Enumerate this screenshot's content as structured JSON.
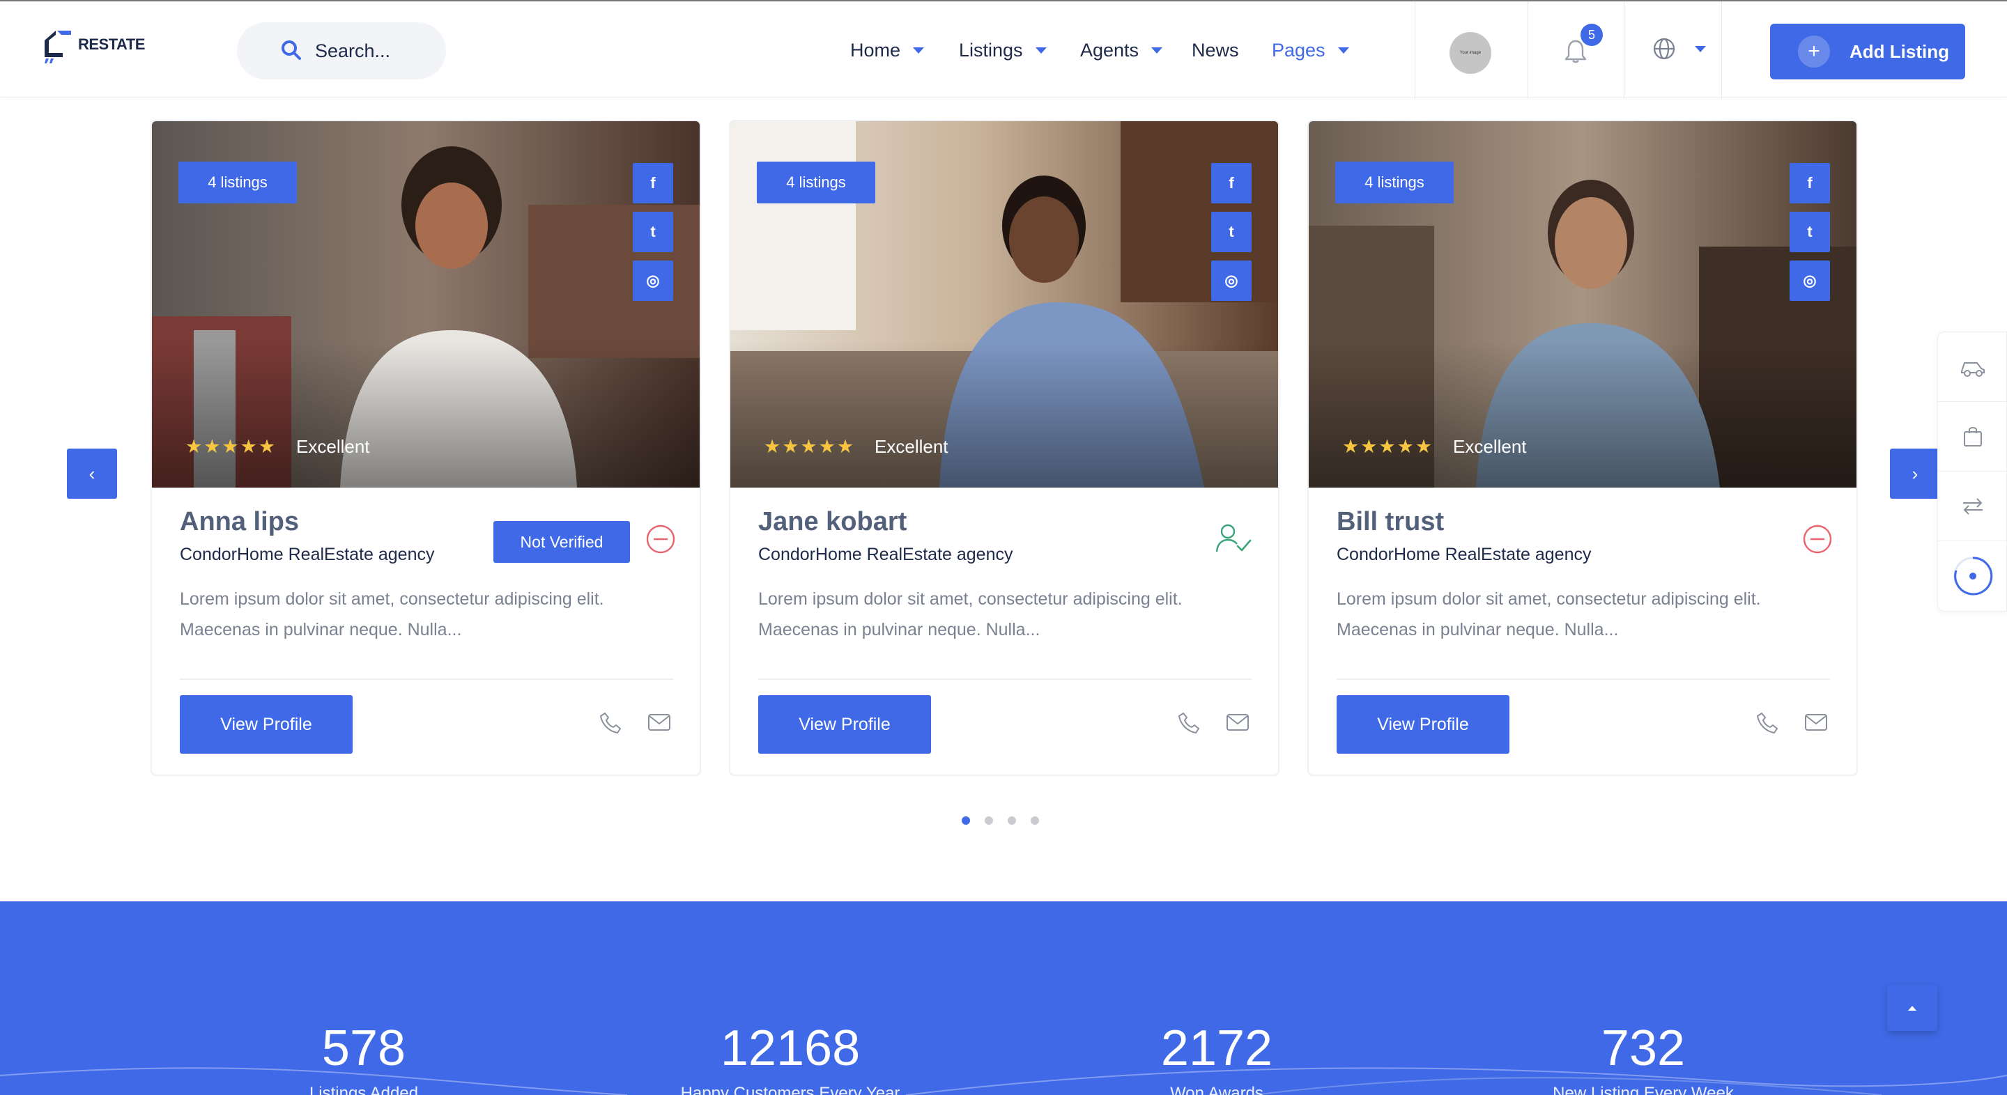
{
  "header": {
    "logo_text": "RESTATE",
    "search_placeholder": "Search...",
    "nav": [
      {
        "label": "Home",
        "has_caret": true,
        "active": false
      },
      {
        "label": "Listings",
        "has_caret": true,
        "active": false
      },
      {
        "label": "Agents",
        "has_caret": true,
        "active": false
      },
      {
        "label": "News",
        "has_caret": false,
        "active": false
      },
      {
        "label": "Pages",
        "has_caret": true,
        "active": true
      }
    ],
    "avatar_text": "Your image",
    "notification_count": "5",
    "language_icon": "globe-icon",
    "add_listing_label": "Add Listing"
  },
  "agents": [
    {
      "listings": "4 listings",
      "rating_label": "Excellent",
      "stars": 5,
      "name": "Anna lips",
      "agency": "CondorHome RealEstate agency",
      "description": "Lorem ipsum dolor sit amet, consectetur adipiscing elit. Maecenas in pulvinar neque. Nulla...",
      "verified_badge": "Not Verified",
      "status_icon": "not-verified-icon",
      "view_label": "View Profile"
    },
    {
      "listings": "4 listings",
      "rating_label": "Excellent",
      "stars": 5,
      "name": "Jane kobart",
      "agency": "CondorHome RealEstate agency",
      "description": "Lorem ipsum dolor sit amet, consectetur adipiscing elit. Maecenas in pulvinar neque. Nulla...",
      "verified_badge": "",
      "status_icon": "verified-user-icon",
      "view_label": "View Profile"
    },
    {
      "listings": "4 listings",
      "rating_label": "Excellent",
      "stars": 5,
      "name": "Bill trust",
      "agency": "CondorHome RealEstate agency",
      "description": "Lorem ipsum dolor sit amet, consectetur adipiscing elit. Maecenas in pulvinar neque. Nulla...",
      "verified_badge": "",
      "status_icon": "not-verified-icon",
      "view_label": "View Profile"
    }
  ],
  "carousel": {
    "pages": 4,
    "active_page": 1
  },
  "stats": [
    {
      "value": "578",
      "label": "Listings Added"
    },
    {
      "value": "12168",
      "label": "Happy Customers Every Year"
    },
    {
      "value": "2172",
      "label": "Won Awards"
    },
    {
      "value": "732",
      "label": "New Listing Every Week"
    }
  ],
  "colors": {
    "accent": "#3f69e6",
    "star": "#f7c542",
    "danger": "#e9646f",
    "success": "#3aa57a"
  }
}
